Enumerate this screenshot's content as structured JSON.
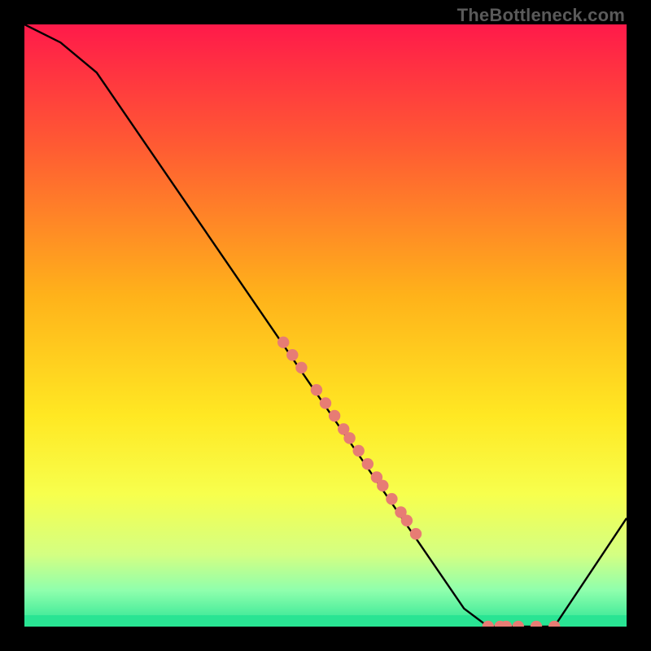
{
  "watermark": "TheBottleneck.com",
  "colors": {
    "line": "#000000",
    "marker_fill": "#e77c74",
    "marker_stroke": "#d46059",
    "bottom_band": "#29e493",
    "axis_outline": "#000000"
  },
  "chart_data": {
    "type": "line",
    "title": "",
    "xlabel": "",
    "ylabel": "",
    "xlim": [
      0,
      100
    ],
    "ylim": [
      0,
      100
    ],
    "gradient_stops": [
      {
        "offset": 0.0,
        "color": "#ff1a4a"
      },
      {
        "offset": 0.2,
        "color": "#ff5a33"
      },
      {
        "offset": 0.45,
        "color": "#ffb21a"
      },
      {
        "offset": 0.65,
        "color": "#ffe823"
      },
      {
        "offset": 0.78,
        "color": "#f7ff4d"
      },
      {
        "offset": 0.88,
        "color": "#d4ff82"
      },
      {
        "offset": 0.94,
        "color": "#8fffad"
      },
      {
        "offset": 1.0,
        "color": "#29e493"
      }
    ],
    "curve": [
      {
        "x": 0,
        "y": 100
      },
      {
        "x": 6,
        "y": 97
      },
      {
        "x": 12,
        "y": 92
      },
      {
        "x": 73,
        "y": 3
      },
      {
        "x": 77,
        "y": 0
      },
      {
        "x": 88,
        "y": 0
      },
      {
        "x": 100,
        "y": 18
      }
    ],
    "markers_on_slope": [
      {
        "x": 43,
        "y": 47.2
      },
      {
        "x": 44.5,
        "y": 45.1
      },
      {
        "x": 46,
        "y": 43.0
      },
      {
        "x": 48.5,
        "y": 39.3
      },
      {
        "x": 50,
        "y": 37.1
      },
      {
        "x": 51.5,
        "y": 35.0
      },
      {
        "x": 53,
        "y": 32.8
      },
      {
        "x": 54,
        "y": 31.3
      },
      {
        "x": 55.5,
        "y": 29.2
      },
      {
        "x": 57,
        "y": 27.0
      },
      {
        "x": 58.5,
        "y": 24.8
      },
      {
        "x": 59.5,
        "y": 23.4
      },
      {
        "x": 61,
        "y": 21.2
      },
      {
        "x": 62.5,
        "y": 19.0
      },
      {
        "x": 63.5,
        "y": 17.6
      },
      {
        "x": 65,
        "y": 15.4
      }
    ],
    "markers_at_bottom": [
      {
        "x": 77,
        "y": 0
      },
      {
        "x": 79,
        "y": 0
      },
      {
        "x": 80,
        "y": 0
      },
      {
        "x": 82,
        "y": 0
      },
      {
        "x": 85,
        "y": 0
      },
      {
        "x": 88,
        "y": 0
      }
    ]
  }
}
